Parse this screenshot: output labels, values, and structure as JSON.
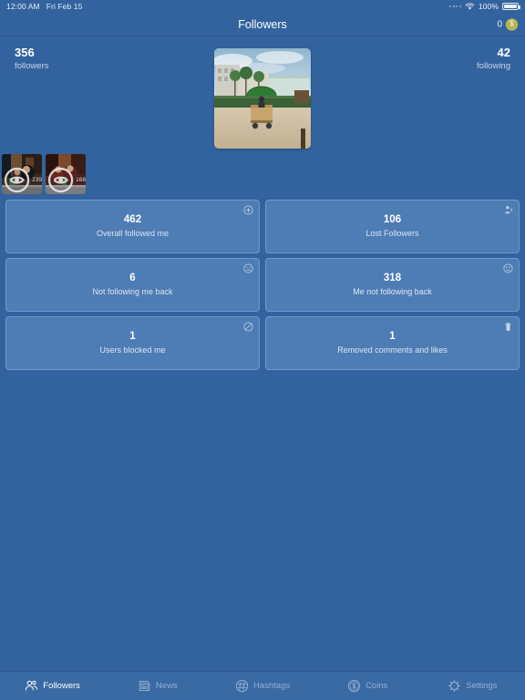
{
  "statusbar": {
    "time": "12:00 AM",
    "date": "Fri Feb 15",
    "battery_percent": "100%",
    "wifi_icon": "wifi-icon",
    "battery_icon": "battery-icon",
    "signal_icon": "signal-dots-icon"
  },
  "navbar": {
    "title": "Followers",
    "coin_count": "0",
    "coin_symbol": "$",
    "coin_icon": "coin-icon"
  },
  "header": {
    "followers_count": "356",
    "followers_label": "followers",
    "following_count": "42",
    "following_label": "following"
  },
  "media": {
    "hero_alt": "beach-vendor-cart-photo",
    "thumbnails": [
      {
        "alt": "indoor-restaurant-photo-1",
        "views": "239",
        "icon": "eye-icon"
      },
      {
        "alt": "indoor-restaurant-photo-2",
        "views": "168",
        "icon": "eye-icon"
      }
    ]
  },
  "cards": [
    {
      "value": "462",
      "label": "Overall followed me",
      "icon": "plus-circle-icon"
    },
    {
      "value": "106",
      "label": "Lost Followers",
      "icon": "user-leaving-icon"
    },
    {
      "value": "6",
      "label": "Not following me back",
      "icon": "sad-face-icon"
    },
    {
      "value": "318",
      "label": "Me not following back",
      "icon": "confused-face-icon"
    },
    {
      "value": "1",
      "label": "Users blocked me",
      "icon": "block-circle-icon"
    },
    {
      "value": "1",
      "label": "Removed comments and likes",
      "icon": "trash-icon"
    }
  ],
  "tabbar": [
    {
      "label": "Followers",
      "icon": "people-icon",
      "active": true
    },
    {
      "label": "News",
      "icon": "newspaper-icon",
      "active": false
    },
    {
      "label": "Hashtags",
      "icon": "hashtag-circle-icon",
      "active": false
    },
    {
      "label": "Coins",
      "icon": "dollar-circle-icon",
      "active": false
    },
    {
      "label": "Settings",
      "icon": "gear-icon",
      "active": false
    }
  ],
  "colors": {
    "page_background": "#33639e",
    "card_background": "#4e7cb4",
    "card_border": "#6e99cb",
    "accent_text": "#ffffff",
    "muted_text": "#c3d3e7",
    "tab_inactive": "#93b0d2",
    "coin_badge": "#b5b04a"
  }
}
